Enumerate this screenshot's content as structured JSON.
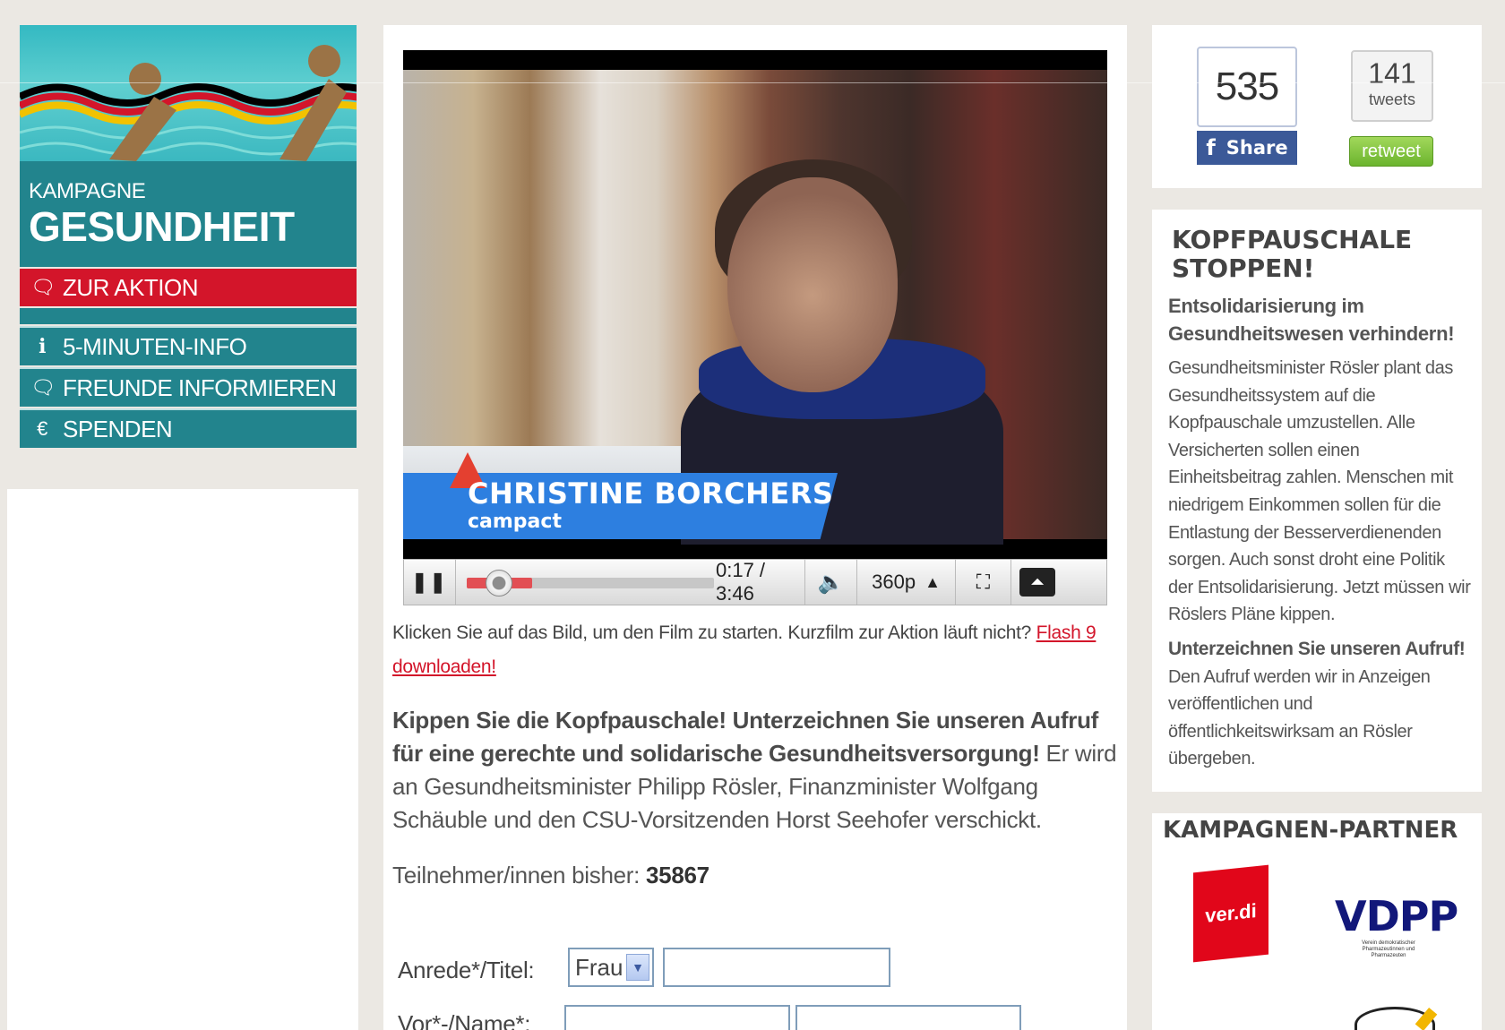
{
  "sidebar": {
    "kampagne_label": "KAMPAGNE",
    "kampagne_title": "GESUNDHEIT",
    "items": [
      {
        "label": "ZUR AKTION",
        "icon": "speech-bubble-icon"
      },
      {
        "label": "5-MINUTEN-INFO",
        "icon": "info-icon"
      },
      {
        "label": "FREUNDE INFORMIEREN",
        "icon": "speech-bubble-icon"
      },
      {
        "label": "SPENDEN",
        "icon": "euro-icon"
      }
    ]
  },
  "video": {
    "lower_third_name": "CHRISTINE BORCHERS",
    "lower_third_sub": "campact",
    "time": "0:17 / 3:46",
    "quality": "360p",
    "progress_fraction": 0.075
  },
  "main": {
    "note_text": "Klicken Sie auf das Bild, um den Film zu starten. Kurzfilm zur Aktion läuft nicht? ",
    "note_link": "Flash 9 downloaden!",
    "lead_bold": "Kippen Sie die Kopfpauschale! Unterzeichnen Sie unseren Aufruf für eine gerechte und solidarische Gesundheitsversorgung!",
    "lead_rest": " Er wird an Gesundheitsminister Philipp Rösler, Finanzminister Wolfgang Schäuble und den CSU-Vorsitzenden Horst Seehofer verschickt.",
    "count_label": "Teilnehmer/innen bisher: ",
    "count_value": "35867",
    "form": {
      "anrede_label": "Anrede*/Titel:",
      "anrede_value": "Frau",
      "name_label": "Vor*-/Name*:"
    }
  },
  "social": {
    "fb_count": "535",
    "fb_share": "Share",
    "tw_count": "141",
    "tw_label": "tweets",
    "tw_button": "retweet"
  },
  "info": {
    "title": "KOPFPAUSCHALE STOPPEN!",
    "subtitle": "Entsolidarisierung im Gesundheitswesen verhindern!",
    "body": "Gesundheitsminister Rösler plant das Gesundheitssystem auf die Kopfpauschale umzustellen. Alle Versicherten sollen einen Einheitsbeitrag zahlen. Menschen mit niedrigem Einkommen sollen für die Entlastung der Besserverdienenden sorgen. Auch sonst droht eine Politik der Entsolidarisierung. Jetzt müssen wir Röslers Pläne kippen.",
    "cta_bold": "Unterzeichnen Sie unseren Aufruf!",
    "cta_rest": " Den Aufruf werden wir in Anzeigen veröffentlichen und öffentlichkeitswirksam an Rösler übergeben."
  },
  "partners": {
    "title": "KAMPAGNEN-PARTNER",
    "verdi": "ver.di",
    "vdpp": "VDPP",
    "vdpp_sub": "Verein demokratischer Pharmazeutinnen und Pharmazeuten"
  },
  "colors": {
    "accent_red": "#d3152a",
    "teal": "#22848d",
    "facebook": "#3b5998",
    "retweet_green": "#6bb42e"
  }
}
